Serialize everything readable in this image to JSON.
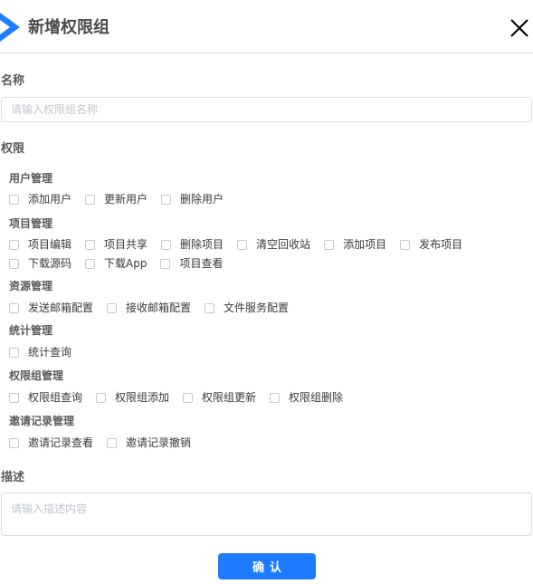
{
  "dialog": {
    "title": "新增权限组",
    "brand_color": "#1e7bff"
  },
  "name_section": {
    "label": "名称",
    "placeholder": "请输入权限组名称"
  },
  "permission_section": {
    "label": "权限",
    "groups": [
      {
        "title": "用户管理",
        "rows": [
          [
            "添加用户",
            "更新用户",
            "删除用户"
          ]
        ]
      },
      {
        "title": "项目管理",
        "rows": [
          [
            "项目编辑",
            "项目共享",
            "删除项目",
            "清空回收站",
            "添加项目",
            "发布项目"
          ],
          [
            "下载源码",
            "下载App",
            "项目查看"
          ]
        ]
      },
      {
        "title": "资源管理",
        "rows": [
          [
            "发送邮箱配置",
            "接收邮箱配置",
            "文件服务配置"
          ]
        ]
      },
      {
        "title": "统计管理",
        "rows": [
          [
            "统计查询"
          ]
        ]
      },
      {
        "title": "权限组管理",
        "rows": [
          [
            "权限组查询",
            "权限组添加",
            "权限组更新",
            "权限组删除"
          ]
        ]
      },
      {
        "title": "邀请记录管理",
        "rows": [
          [
            "邀请记录查看",
            "邀请记录撤销"
          ]
        ]
      }
    ]
  },
  "description_section": {
    "label": "描述",
    "placeholder": "请输入描述内容"
  },
  "footer": {
    "confirm_label": "确认"
  }
}
